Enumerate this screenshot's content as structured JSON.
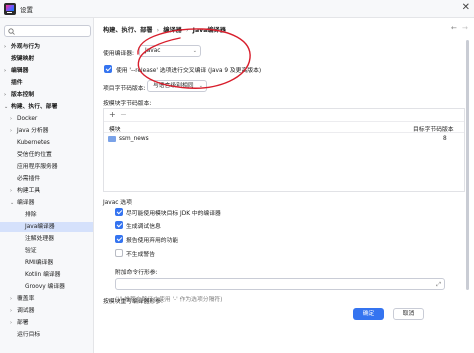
{
  "window": {
    "title": "设置",
    "close_glyph": "✕",
    "app_icon": "jetbrains-app-icon"
  },
  "sidebar": {
    "search_placeholder": "",
    "items": [
      {
        "label": "外观与行为",
        "chevron": "›",
        "bold": true
      },
      {
        "label": "按键映射",
        "chevron": "",
        "bold": true
      },
      {
        "label": "编辑器",
        "chevron": "›",
        "bold": true
      },
      {
        "label": "插件",
        "chevron": "",
        "bold": true
      },
      {
        "label": "版本控制",
        "chevron": "›",
        "bold": true
      },
      {
        "label": "构建、执行、部署",
        "chevron": "⌄",
        "bold": true
      },
      {
        "label": "Docker",
        "chevron": "›",
        "bold": false
      },
      {
        "label": "Java 分析器",
        "chevron": "›",
        "bold": false
      },
      {
        "label": "Kubernetes",
        "chevron": "",
        "bold": false
      },
      {
        "label": "受信任的位置",
        "chevron": "",
        "bold": false
      },
      {
        "label": "应用程序服务器",
        "chevron": "",
        "bold": false
      },
      {
        "label": "必需插件",
        "chevron": "",
        "bold": false
      },
      {
        "label": "构建工具",
        "chevron": "›",
        "bold": false
      },
      {
        "label": "编译器",
        "chevron": "⌄",
        "bold": false
      },
      {
        "label": "排除",
        "chevron": "",
        "bold": false
      },
      {
        "label": "Java编译器",
        "chevron": "",
        "bold": false
      },
      {
        "label": "注解处理器",
        "chevron": "",
        "bold": false
      },
      {
        "label": "验证",
        "chevron": "",
        "bold": false
      },
      {
        "label": "RMI编译器",
        "chevron": "",
        "bold": false
      },
      {
        "label": "Kotlin 编译器",
        "chevron": "",
        "bold": false
      },
      {
        "label": "Groovy 编译器",
        "chevron": "",
        "bold": false
      },
      {
        "label": "覆盖率",
        "chevron": "›",
        "bold": false
      },
      {
        "label": "调试器",
        "chevron": "›",
        "bold": false
      },
      {
        "label": "部署",
        "chevron": "›",
        "bold": false
      },
      {
        "label": "运行目标",
        "chevron": "",
        "bold": false
      }
    ]
  },
  "breadcrumb": {
    "items": [
      "构建、执行、部署",
      "编译器",
      "Java编译器"
    ],
    "separator": "›",
    "back_glyph": "←",
    "forward_glyph": "→"
  },
  "compiler": {
    "use_compiler_label": "使用编译器:",
    "compiler_value": "Javac",
    "release_option_label": "使用 '--release' 选项进行交叉编译 (Java 9 及更高版本)",
    "release_option_checked": true,
    "project_bytecode_label": "项目字节码版本:",
    "project_bytecode_value": "与语言级别相同",
    "per_module_label": "按模块字节码版本:"
  },
  "module_table": {
    "add_glyph": "+",
    "remove_glyph": "−",
    "headers": [
      "模块",
      "目标字节码版本"
    ],
    "rows": [
      {
        "module": "ssm_news",
        "target": "8"
      }
    ]
  },
  "javac_options": {
    "section_title": "Javac 选项",
    "options": [
      {
        "label": "尽可能使用模块目标 JDK 中的编译器",
        "checked": true
      },
      {
        "label": "生成调试信息",
        "checked": true
      },
      {
        "label": "报告使用弃用的功能",
        "checked": true
      },
      {
        "label": "不生成警告",
        "checked": false
      }
    ],
    "extra_params_label": "附加命令行形参:",
    "extra_params_value": "",
    "extra_params_hint": "('/' 推荐在路径中使用 '-' 作为选项分隔符)",
    "per_module_override_label": "按模块重写编译器形参:"
  },
  "buttons": {
    "ok": "确定",
    "cancel": "取消"
  },
  "colors": {
    "accent": "#3574f0",
    "selection": "#d5e1fb",
    "annotation": "#d81e2c"
  }
}
